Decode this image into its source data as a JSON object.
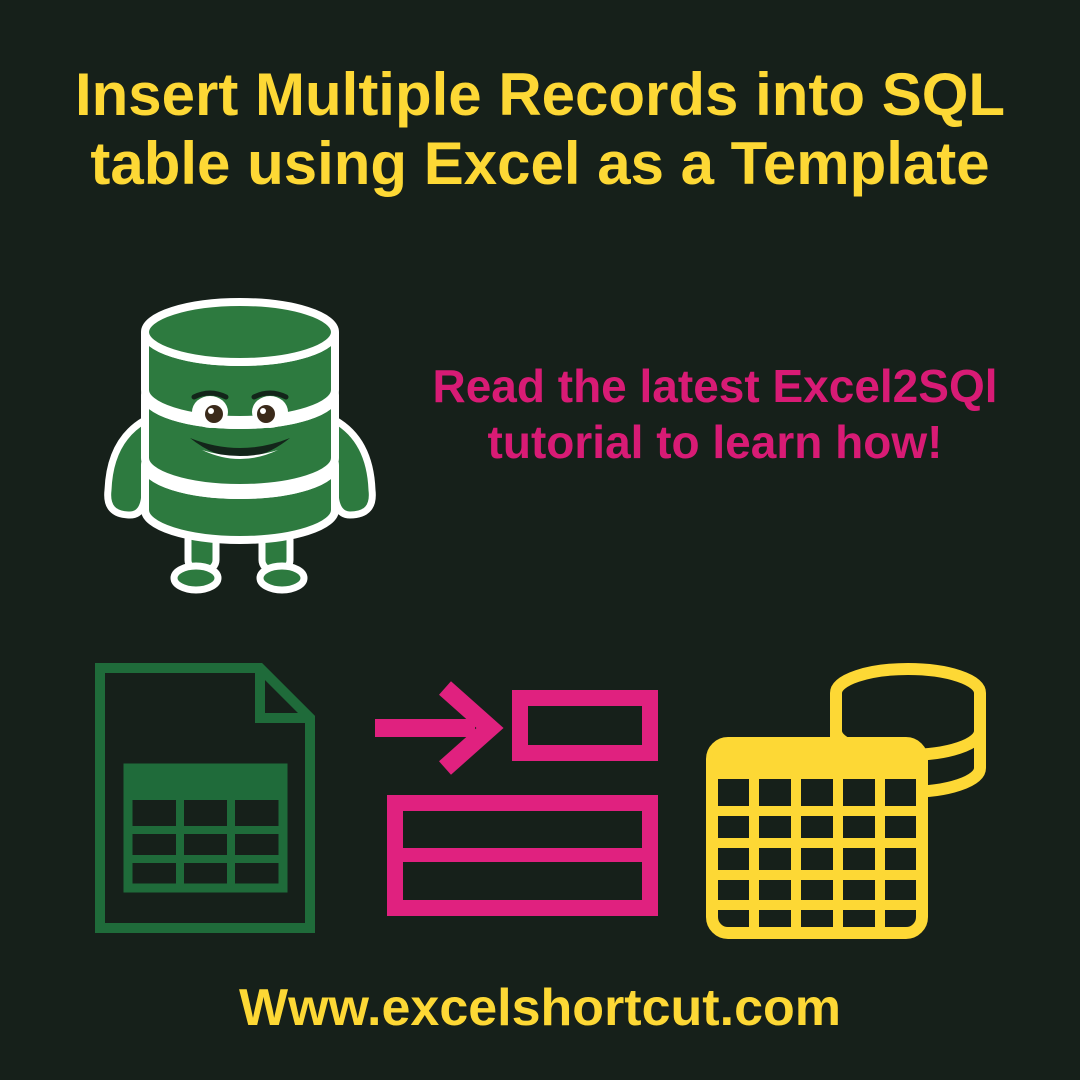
{
  "headline": "Insert Multiple Records into SQL table using Excel as a Template",
  "subhead": "Read the latest Excel2SQl tutorial to learn how!",
  "footer_url": "Www.excelshortcut.com",
  "colors": {
    "background": "#16201a",
    "yellow": "#fdd835",
    "magenta": "#d81b75",
    "green": "#1f6b3a",
    "darkGreen": "#2d7a3f"
  }
}
